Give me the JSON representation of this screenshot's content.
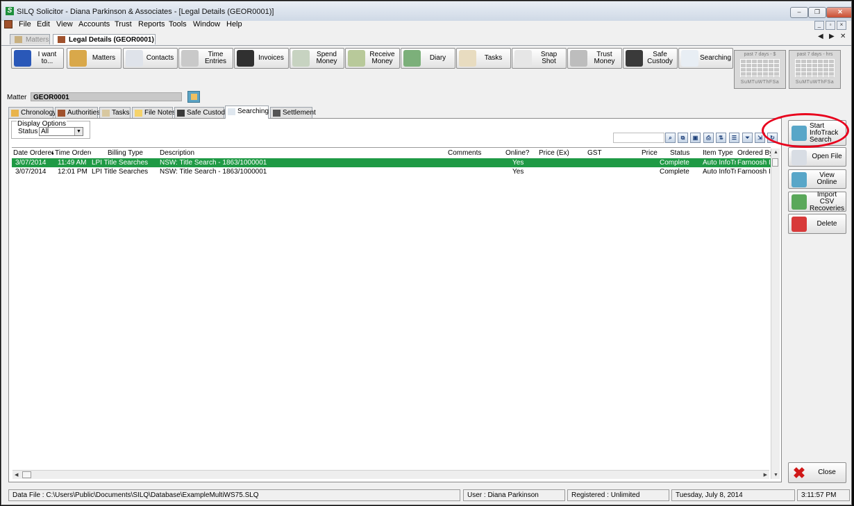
{
  "window": {
    "title": "SILQ Solicitor - Diana Parkinson & Associates - [Legal Details (GEOR0001)]",
    "logo_letter": "S",
    "controls": {
      "minimize": "‒",
      "maximize": "❐",
      "close": "✕"
    },
    "mdi_controls": {
      "minimize": "_",
      "restore": "▫",
      "close": "×"
    }
  },
  "menu": [
    "File",
    "Edit",
    "View",
    "Accounts",
    "Trust",
    "Reports",
    "Tools",
    "Window",
    "Help"
  ],
  "doc_tabs": {
    "matters": "Matters",
    "legal": "Legal Details (GEOR0001)",
    "prev": "◀",
    "next": "▶",
    "close": "✕"
  },
  "toolbar": [
    {
      "label": "I want to...",
      "icon": "question-icon",
      "color": "#2a58b8"
    },
    {
      "label": "Matters",
      "icon": "matters-icon",
      "color": "#d9a84a"
    },
    {
      "label": "Contacts",
      "icon": "contacts-icon",
      "color": "#dfe3ea"
    },
    {
      "label": "Time Entries",
      "icon": "stopwatch-icon",
      "color": "#c9c9c9"
    },
    {
      "label": "Invoices",
      "icon": "calculator-icon",
      "color": "#303030"
    },
    {
      "label": "Spend Money",
      "icon": "cheque-icon",
      "color": "#c7d3c1"
    },
    {
      "label": "Receive Money",
      "icon": "receive-money-icon",
      "color": "#b8c99a"
    },
    {
      "label": "Diary",
      "icon": "diary-icon",
      "color": "#7cb07a"
    },
    {
      "label": "Tasks",
      "icon": "tasks-icon",
      "color": "#e8dcc0"
    },
    {
      "label": "Snap Shot",
      "icon": "chart-icon",
      "color": "#e6e6e6"
    },
    {
      "label": "Trust Money",
      "icon": "bank-icon",
      "color": "#bdbdbd"
    },
    {
      "label": "Safe Custody",
      "icon": "safe-icon",
      "color": "#3a3a3a"
    },
    {
      "label": "Searching",
      "icon": "magnifier-icon",
      "color": "#e8eef4"
    }
  ],
  "mini_panels": [
    {
      "title": "past 7 days - $",
      "days": "SuMTuWThFSa"
    },
    {
      "title": "past 7 days - hrs",
      "days": "SuMTuWThFSa"
    }
  ],
  "matter": {
    "label": "Matter",
    "value": "GEOR0001"
  },
  "tabs": [
    {
      "label": "Chronology",
      "icon": "chronology-icon",
      "color": "#e9b44c"
    },
    {
      "label": "Authorities",
      "icon": "authorities-icon",
      "color": "#a0522d"
    },
    {
      "label": "Tasks",
      "icon": "tasks-icon",
      "color": "#d8c8a0"
    },
    {
      "label": "File Notes",
      "icon": "file-notes-icon",
      "color": "#f5d36b"
    },
    {
      "label": "Safe Custody",
      "icon": "safe-icon",
      "color": "#3a3a3a"
    },
    {
      "label": "Searching",
      "icon": "magnifier-icon",
      "color": "#dfe7ef"
    },
    {
      "label": "Settlement",
      "icon": "settlement-icon",
      "color": "#555555"
    }
  ],
  "display_options": {
    "legend": "Display Options",
    "status_label": "Status",
    "status_value": "All",
    "dropdown_glyph": "▼"
  },
  "grid_tools": [
    {
      "name": "find-icon",
      "glyph": "⌕"
    },
    {
      "name": "copy-icon",
      "glyph": "⧉"
    },
    {
      "name": "save-icon",
      "glyph": "▣"
    },
    {
      "name": "print-icon",
      "glyph": "⎙"
    },
    {
      "name": "sort-icon",
      "glyph": "⇅"
    },
    {
      "name": "columns-icon",
      "glyph": "☰"
    },
    {
      "name": "filter-icon",
      "glyph": "⏷"
    },
    {
      "name": "export-icon",
      "glyph": "⇲"
    },
    {
      "name": "refresh-icon",
      "glyph": "↻"
    }
  ],
  "grid": {
    "columns": [
      "Date Ordered",
      "Time Ordered",
      "Billing Type",
      "Description",
      "Comments",
      "Online?",
      "Price (Ex)",
      "GST",
      "Price",
      "Status",
      "Item Type",
      "Ordered By"
    ],
    "rows": [
      {
        "date": "3/07/2014",
        "time": "11:49 AM",
        "billing": "LPI Title Searches",
        "description": "NSW: Title Search - 1863/1000001",
        "comments": "",
        "online": "Yes",
        "price_ex": "",
        "gst": "",
        "price": "",
        "status": "Complete",
        "item_type": "Auto InfoTrack",
        "ordered_by": "Farnoosh Irani",
        "selected": true
      },
      {
        "date": "3/07/2014",
        "time": "12:01 PM",
        "billing": "LPI Title Searches",
        "description": "NSW: Title Search - 1863/1000001",
        "comments": "",
        "online": "Yes",
        "price_ex": "",
        "gst": "",
        "price": "",
        "status": "Complete",
        "item_type": "Auto InfoTrack",
        "ordered_by": "Farnoosh Irani",
        "selected": false
      }
    ],
    "sort_glyph": "▴"
  },
  "side_buttons": [
    {
      "label": "Start InfoTrack Search",
      "icon": "infotrack-icon",
      "color": "#58a6c8"
    },
    {
      "label": "Open File",
      "icon": "open-file-icon",
      "color": "#d8dde4"
    },
    {
      "label": "View Online",
      "icon": "view-online-icon",
      "color": "#58a6c8"
    },
    {
      "label": "Import CSV Recoveries",
      "icon": "import-csv-icon",
      "color": "#5aa85a"
    },
    {
      "label": "Delete",
      "icon": "delete-icon",
      "color": "#d83a3a"
    }
  ],
  "close_button": {
    "label": "Close",
    "glyph": "✖"
  },
  "statusbar": {
    "data_file": "Data File : C:\\Users\\Public\\Documents\\SILQ\\Database\\ExampleMultiWS75.SLQ",
    "user": "User : Diana Parkinson",
    "registered": "Registered : Unlimited",
    "date": "Tuesday, July  8, 2014",
    "time": "3:11:57 PM"
  },
  "colors": {
    "selected_row": "#1f9a45",
    "highlight": "#e8001c",
    "delete_red": "#d01818"
  }
}
